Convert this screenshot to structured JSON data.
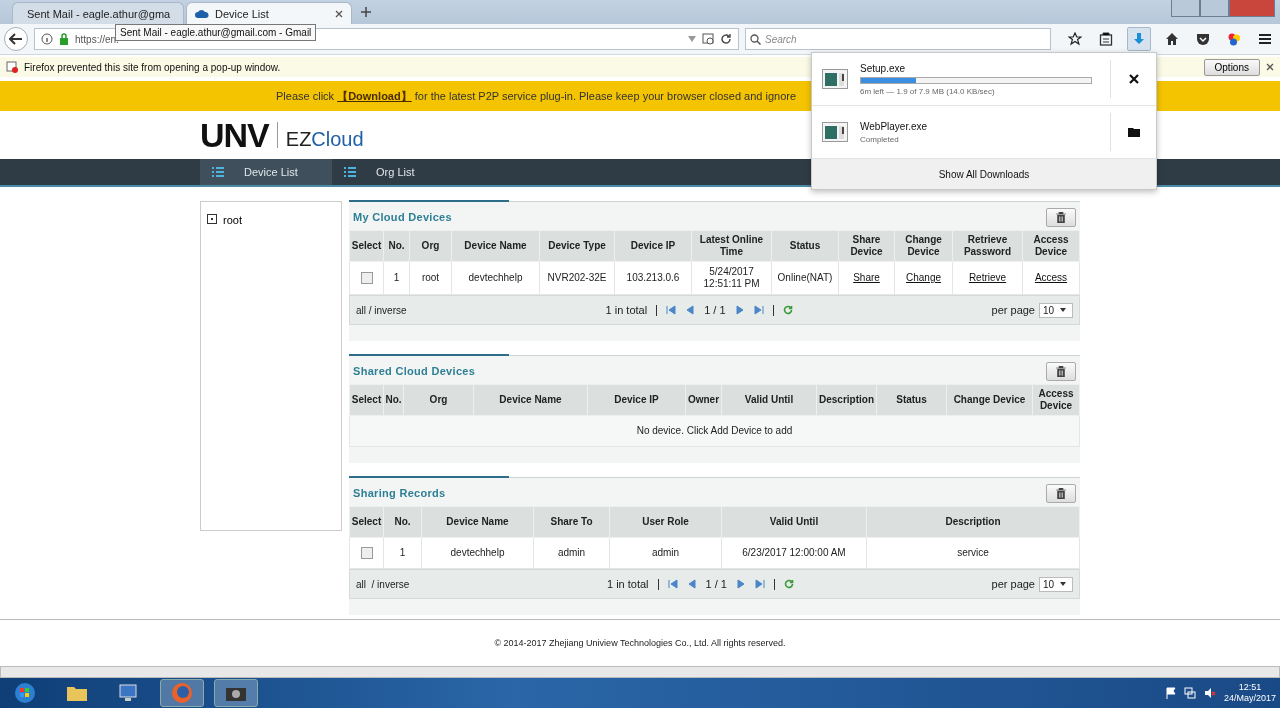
{
  "browser": {
    "tabs": [
      {
        "title": "Sent Mail - eagle.athur@gma",
        "selected": false
      },
      {
        "title": "Device List",
        "selected": true
      }
    ],
    "tooltip": "Sent Mail - eagle.athur@gmail.com - Gmail",
    "url": "https://en.",
    "search_placeholder": "Search",
    "notice": "Firefox prevented this site from opening a pop-up window.",
    "options_button": "Options"
  },
  "banner": {
    "before": "Please click ",
    "link": "【Download】",
    "after": " for the latest P2P service plug-in. Please keep your browser closed and ignore"
  },
  "logo": {
    "brand": "UNV",
    "product_a": "EZ",
    "product_b": "Cloud"
  },
  "nav": [
    {
      "label": "Device List",
      "selected": true
    },
    {
      "label": "Org List",
      "selected": false
    }
  ],
  "tree": {
    "root": "root"
  },
  "panels": [
    {
      "title": "My Cloud Devices",
      "columns": [
        "Select",
        "No.",
        "Org",
        "Device Name",
        "Device Type",
        "Device IP",
        "Latest Online Time",
        "Status",
        "Share Device",
        "Change Device",
        "Retrieve Password",
        "Access Device"
      ],
      "rows": [
        {
          "cells": [
            {
              "kind": "checkbox",
              "checked": false
            },
            {
              "text": "1",
              "kind": "text"
            },
            {
              "text": "root",
              "kind": "text"
            },
            {
              "text": "devtechhelp",
              "kind": "text"
            },
            {
              "text": "NVR202-32E",
              "kind": "text"
            },
            {
              "text": "103.213.0.6",
              "kind": "text"
            },
            {
              "text": "5/24/2017 12:51:11 PM",
              "kind": "text"
            },
            {
              "text": "Online(NAT)",
              "kind": "text"
            },
            {
              "text": "Share",
              "kind": "link"
            },
            {
              "text": "Change",
              "kind": "link"
            },
            {
              "text": "Retrieve",
              "kind": "link"
            },
            {
              "text": "Access",
              "kind": "link"
            }
          ]
        }
      ],
      "footer": {
        "select": "all / inverse",
        "total": "1 in total",
        "page": "1 / 1",
        "per_page_label": "per page",
        "per_page": "10"
      }
    },
    {
      "title": "Shared Cloud Devices",
      "columns": [
        "Select",
        "No.",
        "Org",
        "Device Name",
        "Device IP",
        "Owner",
        "Valid Until",
        "Description",
        "Status",
        "Change Device",
        "Access Device"
      ],
      "empty": "No device. Click Add Device to add"
    },
    {
      "title": "Sharing Records",
      "columns": [
        "Select",
        "No.",
        "Device Name",
        "Share To",
        "User Role",
        "Valid Until",
        "Description"
      ],
      "rows": [
        {
          "cells": [
            {
              "kind": "checkbox",
              "checked": false
            },
            {
              "text": "1",
              "kind": "text"
            },
            {
              "text": "devtechhelp",
              "kind": "text"
            },
            {
              "text": "admin",
              "kind": "text"
            },
            {
              "text": "admin",
              "kind": "text"
            },
            {
              "text": "6/23/2017 12:00:00 AM",
              "kind": "text"
            },
            {
              "text": "service",
              "kind": "text"
            }
          ]
        }
      ],
      "footer": {
        "select": "all  / inverse",
        "total": "1 in total",
        "page": "1 / 1",
        "per_page_label": "per page",
        "per_page": "10"
      }
    }
  ],
  "copyright": "© 2014-2017 Zhejiang Uniview Technologies Co., Ltd. All rights reserved.",
  "downloads": {
    "items": [
      {
        "name": "Setup.exe",
        "status": "6m left — 1.9 of 7.9 MB (14.0 KB/sec)",
        "kind": "progress",
        "level": 0.24
      },
      {
        "name": "WebPlayer.exe",
        "status": "Completed",
        "kind": "done"
      }
    ],
    "show_all": "Show All Downloads"
  },
  "taskbar": {
    "time": "12:51",
    "date": "24/May/2017"
  }
}
